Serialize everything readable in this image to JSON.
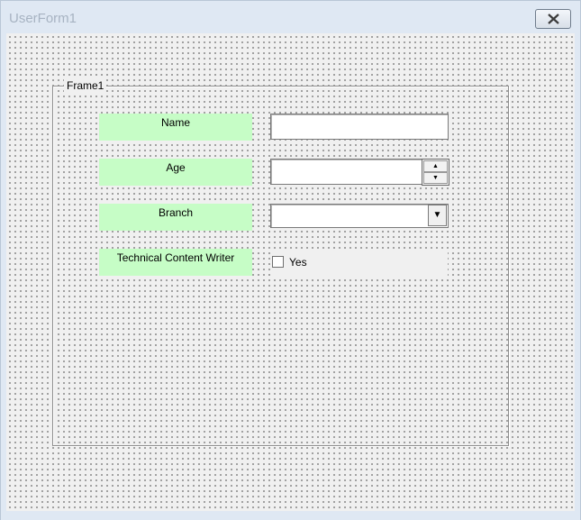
{
  "window": {
    "title": "UserForm1",
    "close_icon": "close-icon"
  },
  "frame": {
    "caption": "Frame1"
  },
  "fields": {
    "name_label": "Name",
    "age_label": "Age",
    "branch_label": "Branch",
    "writer_label": "Technical Content Writer",
    "writer_checkbox_label": "Yes",
    "writer_checked": false
  },
  "colors": {
    "label_background": "#c6fdc6",
    "form_background": "#f0f0f0",
    "titlebar": "#dfe8f3"
  }
}
